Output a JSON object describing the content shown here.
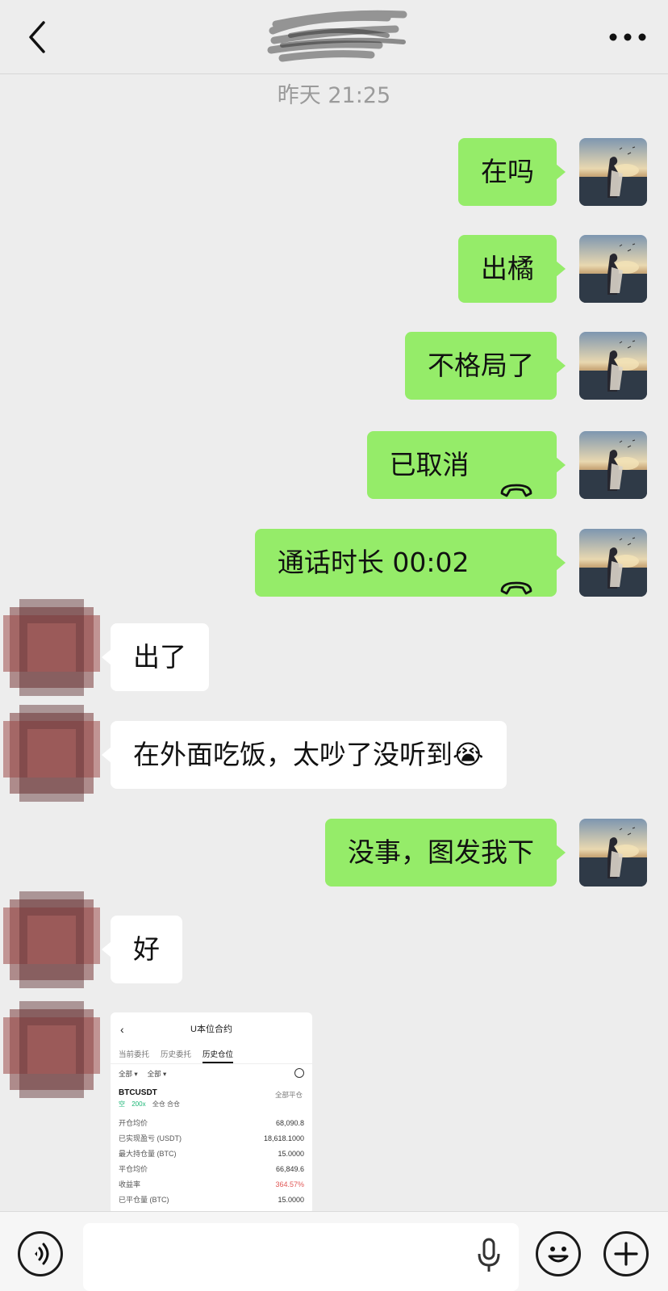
{
  "header": {
    "back_icon": "chevron-left-icon",
    "more_icon": "more-dots-icon"
  },
  "timestamp": "昨天 21:25",
  "messages": [
    {
      "side": "out",
      "text": "在吗"
    },
    {
      "side": "out",
      "text": "出橘"
    },
    {
      "side": "out",
      "text": "不格局了"
    },
    {
      "side": "out",
      "text": "已取消",
      "icon": "phone-hangup-icon"
    },
    {
      "side": "out",
      "text": "通话时长 00:02",
      "icon": "phone-hangup-icon"
    },
    {
      "side": "in",
      "text": "出了"
    },
    {
      "side": "in",
      "text": "在外面吃饭，太吵了没听到😭"
    },
    {
      "side": "out",
      "text": "没事，图发我下"
    },
    {
      "side": "in",
      "text": "好"
    }
  ],
  "screenshot": {
    "title": "U本位合约",
    "tabs": [
      "当前委托",
      "历史委托",
      "历史仓位"
    ],
    "active_tab": "历史仓位",
    "filters": [
      "全部 ▾",
      "全部 ▾"
    ],
    "symbol": "BTCUSDT",
    "close_all": "全部平仓",
    "tag_side": "空",
    "tag_leverage": "200x",
    "tag_mode": "全仓 合仓",
    "rows": [
      {
        "label": "开仓均价",
        "value": "68,090.8"
      },
      {
        "label": "已实现盈亏 (USDT)",
        "value": "18,618.1000"
      },
      {
        "label": "最大持仓量 (BTC)",
        "value": "15.0000"
      },
      {
        "label": "平仓均价",
        "value": "66,849.6"
      },
      {
        "label": "收益率",
        "value": "364.57%",
        "red": true
      },
      {
        "label": "已平仓量 (BTC)",
        "value": "15.0000"
      }
    ]
  },
  "input_bar": {
    "voice_icon": "voice-icon",
    "mic_icon": "microphone-icon",
    "emoji_icon": "emoji-icon",
    "plus_icon": "plus-icon",
    "placeholder": ""
  }
}
